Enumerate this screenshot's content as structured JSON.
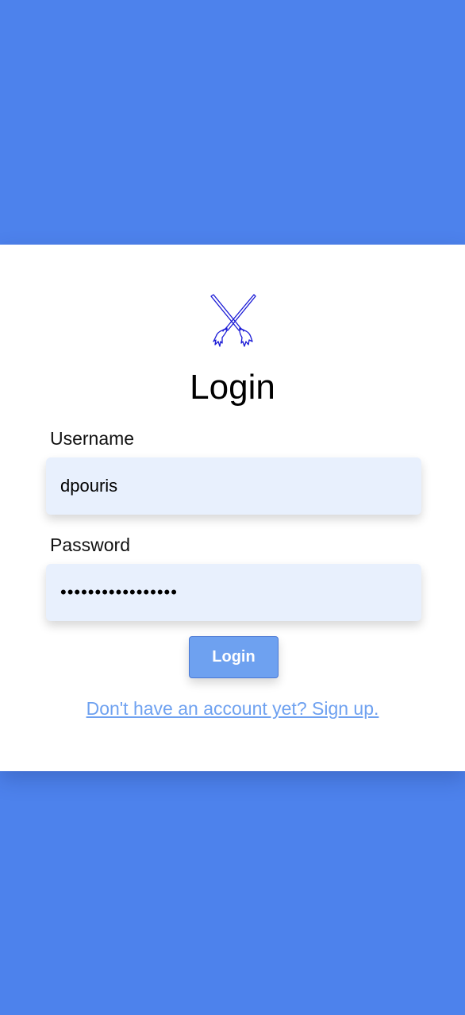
{
  "login": {
    "logo_icon": "crossed-brooms-icon",
    "title": "Login",
    "username_label": "Username",
    "username_value": "dpouris",
    "password_label": "Password",
    "password_value": "•••••••••••••••••",
    "submit_label": "Login",
    "signup_link": "Don't have an account yet? Sign up."
  },
  "colors": {
    "background": "#4d82ec",
    "card": "#ffffff",
    "input_bg": "#e8f0fd",
    "button": "#6ea1f0",
    "link": "#6ea1f0",
    "logo_stroke": "#1a1ad6"
  }
}
